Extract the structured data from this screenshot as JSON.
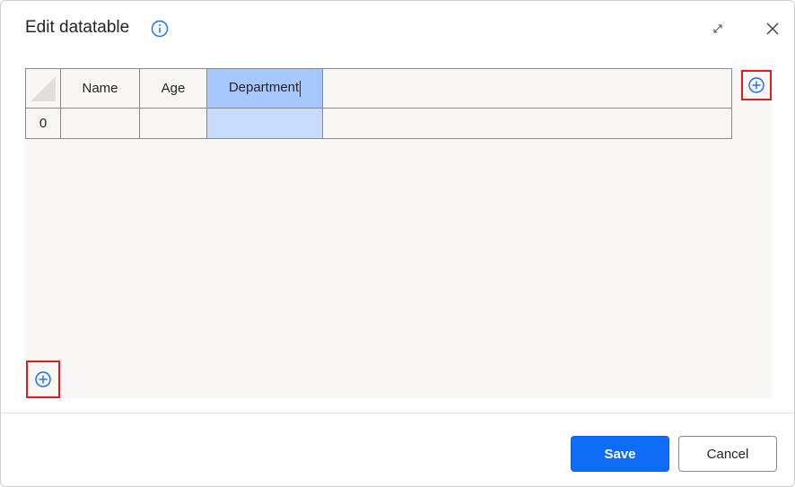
{
  "dialog": {
    "title": "Edit datatable",
    "info_icon": "info-icon",
    "expand_icon": "expand-icon",
    "close_icon": "close-icon"
  },
  "table": {
    "columns": [
      "Name",
      "Age",
      "Department"
    ],
    "selected_column": "Department",
    "rows": [
      {
        "index": "0",
        "cells": [
          "",
          "",
          ""
        ]
      }
    ]
  },
  "add_column_icon": "add-circle-icon",
  "add_row_icon": "add-circle-icon",
  "footer": {
    "save_label": "Save",
    "cancel_label": "Cancel"
  },
  "colors": {
    "accent": "#0f6cf6",
    "selected_header": "#a6c8ff",
    "selected_cell": "#c7dcff",
    "highlight_border": "#d9201f"
  }
}
